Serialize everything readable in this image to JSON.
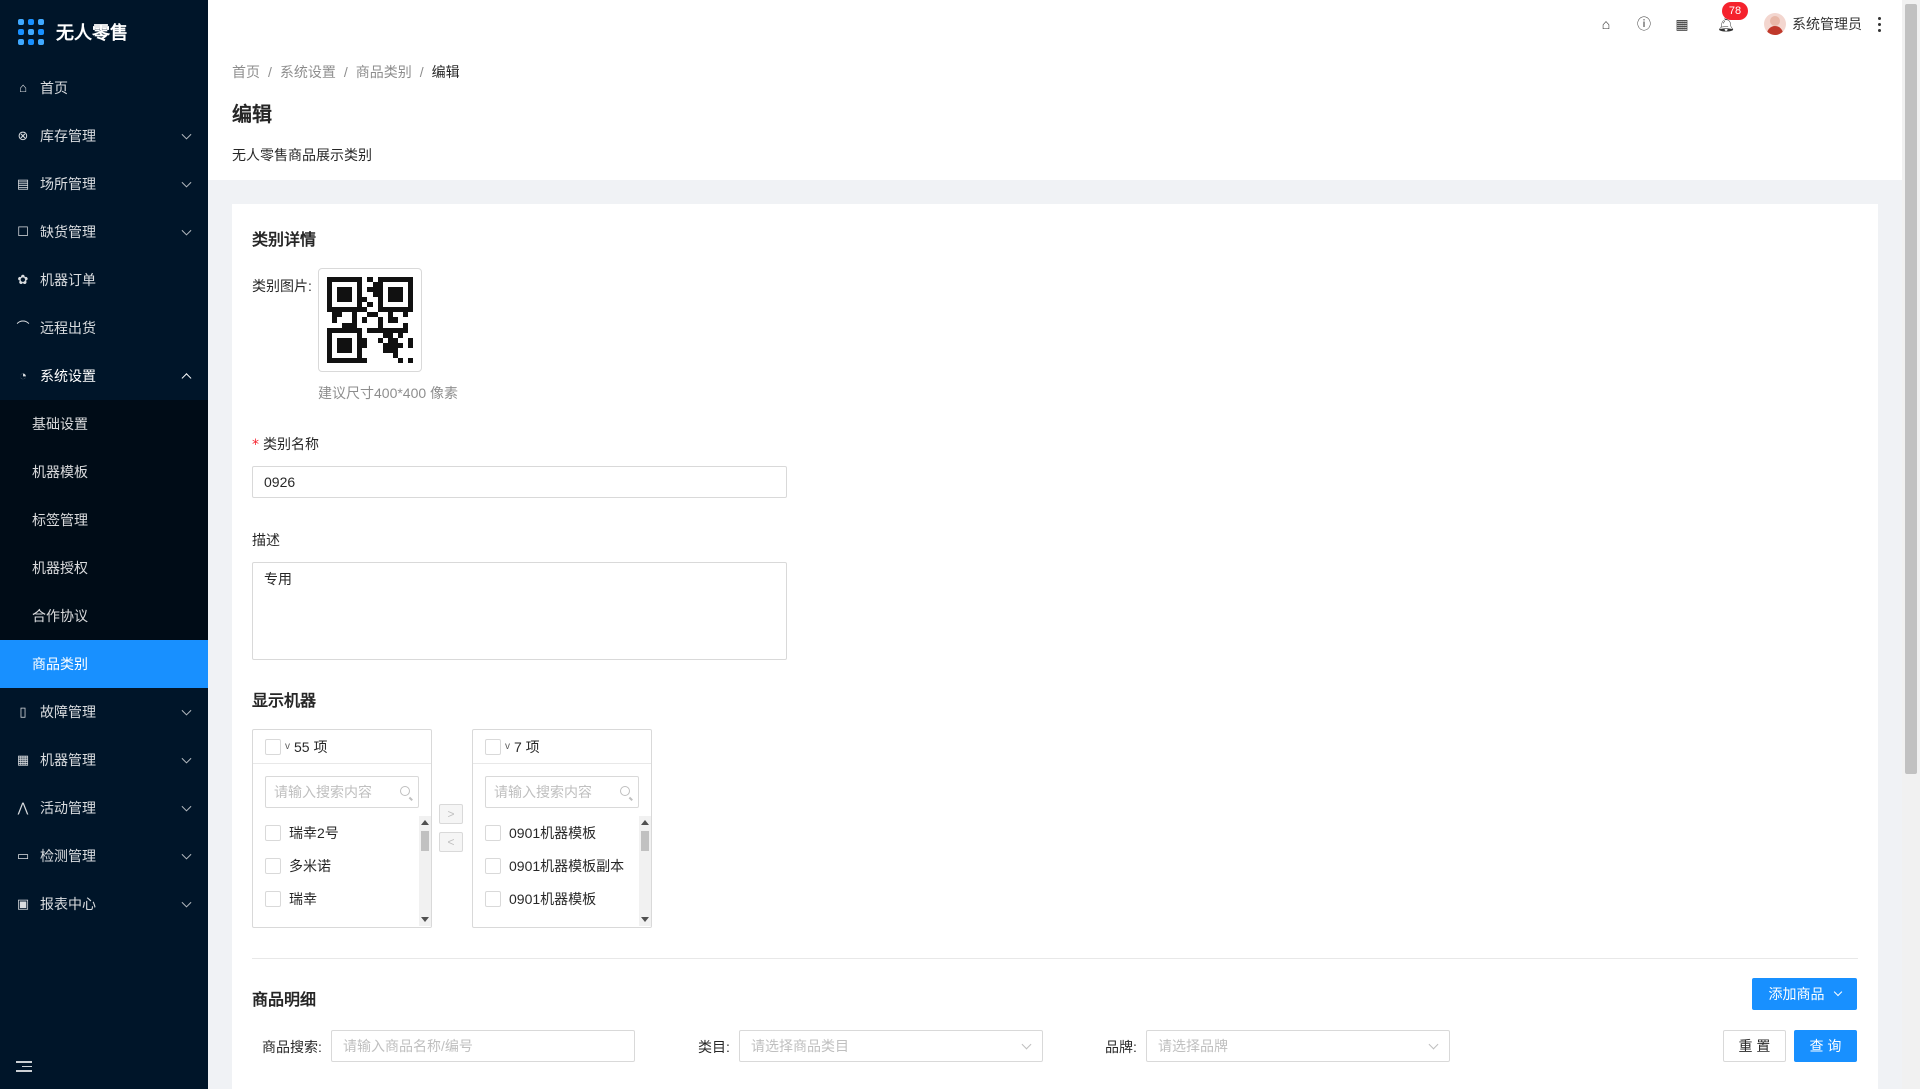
{
  "app": {
    "title": "无人零售"
  },
  "sidebar": {
    "items": [
      {
        "label": "首页",
        "icon": "home-icon"
      },
      {
        "label": "库存管理",
        "icon": "inventory-icon",
        "expandable": true
      },
      {
        "label": "场所管理",
        "icon": "venue-icon",
        "expandable": true
      },
      {
        "label": "缺货管理",
        "icon": "shortage-icon",
        "expandable": true
      },
      {
        "label": "机器订单",
        "icon": "order-icon"
      },
      {
        "label": "远程出货",
        "icon": "remote-ship-icon"
      },
      {
        "label": "系统设置",
        "icon": "settings-icon",
        "expandable": true,
        "open": true
      }
    ],
    "submenu": [
      {
        "label": "基础设置"
      },
      {
        "label": "机器模板"
      },
      {
        "label": "标签管理"
      },
      {
        "label": "机器授权"
      },
      {
        "label": "合作协议"
      },
      {
        "label": "商品类别",
        "active": true
      }
    ],
    "items_after": [
      {
        "label": "故障管理",
        "icon": "fault-icon",
        "expandable": true
      },
      {
        "label": "机器管理",
        "icon": "machine-icon",
        "expandable": true
      },
      {
        "label": "活动管理",
        "icon": "activity-icon",
        "expandable": true
      },
      {
        "label": "检测管理",
        "icon": "inspection-icon",
        "expandable": true
      },
      {
        "label": "报表中心",
        "icon": "report-icon",
        "expandable": true
      }
    ]
  },
  "header": {
    "notification_count": "78",
    "user_name": "系统管理员"
  },
  "breadcrumb": [
    "首页",
    "系统设置",
    "商品类别",
    "编辑"
  ],
  "page": {
    "title": "编辑",
    "description": "无人零售商品展示类别"
  },
  "detail": {
    "section_title": "类别详情",
    "image_label": "类别图片:",
    "image_hint": "建议尺寸400*400 像素",
    "name_label": "类别名称",
    "name_value": "0926",
    "desc_label": "描述",
    "desc_value": "专用"
  },
  "machines": {
    "section_title": "显示机器",
    "left": {
      "count_label": "55 项",
      "search_placeholder": "请输入搜索内容",
      "items": [
        "瑞幸2号",
        "多米诺",
        "瑞幸"
      ]
    },
    "right": {
      "count_label": "7 项",
      "search_placeholder": "请输入搜索内容",
      "items": [
        "0901机器模板",
        "0901机器模板副本",
        "0901机器模板"
      ]
    },
    "to_right": ">",
    "to_left": "<"
  },
  "products": {
    "section_title": "商品明细",
    "add_button": "添加商品",
    "search_label": "商品搜索:",
    "search_placeholder": "请输入商品名称/编号",
    "category_label": "类目:",
    "category_placeholder": "请选择商品类目",
    "brand_label": "品牌:",
    "brand_placeholder": "请选择品牌",
    "reset_button": "重 置",
    "query_button": "查 询"
  },
  "colors": {
    "sidebar_bg": "#001529",
    "primary": "#1890ff",
    "badge": "#f5222d"
  }
}
